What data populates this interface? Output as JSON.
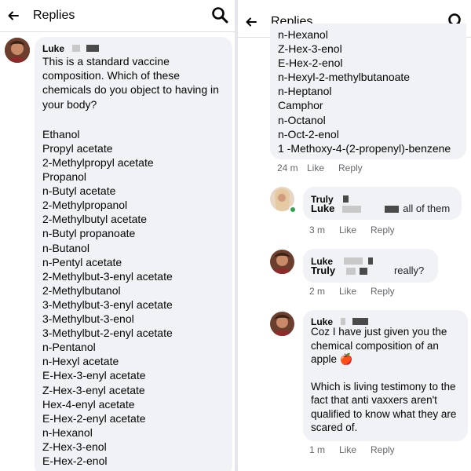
{
  "left": {
    "header_title": "Replies",
    "comment": {
      "author": "Luke",
      "intro": "This is a standard vaccine composition. Which of these chemicals do you object to having in your body?",
      "chemicals": [
        "Ethanol",
        "Propyl acetate",
        "2-Methylpropyl acetate",
        "Propanol",
        "n-Butyl acetate",
        "2-Methylpropanol",
        "2-Methylbutyl acetate",
        "n-Butyl propanoate",
        "n-Butanol",
        "n-Pentyl acetate",
        "2-Methylbut-3-enyl acetate",
        "2-Methylbutanol",
        "3-Methylbut-3-enyl acetate",
        "3-Methylbut-3-enol",
        "3-Methylbut-2-enyl acetate",
        "n-Pentanol",
        "n-Hexyl acetate",
        "E-Hex-3-enyl acetate",
        "Z-Hex-3-enyl acetate",
        "Hex-4-enyl acetate",
        "E-Hex-2-enyl acetate",
        "n-Hexanol",
        "Z-Hex-3-enol",
        "E-Hex-2-enol"
      ]
    }
  },
  "right": {
    "header_title": "Replies",
    "comment_continued": {
      "chemicals": [
        "n-Hexanol",
        "Z-Hex-3-enol",
        "E-Hex-2-enol",
        "n-Hexyl-2-methylbutanoate",
        "n-Heptanol",
        "Camphor",
        "n-Octanol",
        "n-Oct-2-enol",
        "1 -Methoxy-4-(2-propenyl)-benzene"
      ],
      "time": "24 m",
      "like": "Like",
      "reply": "Reply"
    },
    "replies": [
      {
        "author": "Truly",
        "mention": "Luke",
        "text": "all of them",
        "time": "3 m",
        "like": "Like",
        "reply": "Reply"
      },
      {
        "author": "Luke",
        "mention": "Truly",
        "text": "really?",
        "time": "2 m",
        "like": "Like",
        "reply": "Reply"
      },
      {
        "author": "Luke",
        "text1": "Coz I have just given you the chemical composition of an apple",
        "emoji": "🍎",
        "text2": "Which is living testimony to the fact that anti vaxxers aren't qualified to know what they are scared of.",
        "time": "1 m",
        "like": "Like",
        "reply": "Reply"
      }
    ]
  },
  "colors": {
    "bubble": "#f0f2f5",
    "meta_text": "#65676b",
    "online": "#31a24c"
  }
}
